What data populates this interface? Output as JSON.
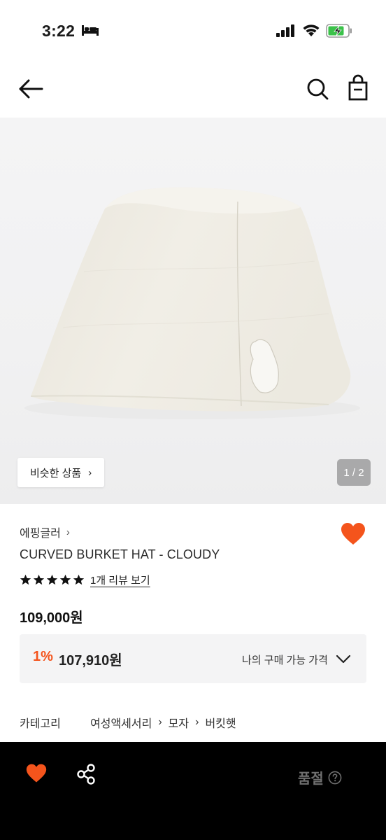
{
  "status_bar": {
    "time": "3:22"
  },
  "nav": {
    "back_icon": "arrow-left-icon",
    "search_icon": "search-icon",
    "bag_icon": "shopping-bag-icon"
  },
  "gallery": {
    "similar_label": "비슷한 상품",
    "counter": "1 / 2"
  },
  "product": {
    "brand": "에핑글러",
    "name": "CURVED BURKET HAT - CLOUDY",
    "rating_stars": 5,
    "review_link": "1개 리뷰 보기",
    "price": "109,000원",
    "liked": true
  },
  "buy_price": {
    "discount_rate": "1%",
    "price": "107,910원",
    "label": "나의 구매 가능 가격"
  },
  "category": {
    "label": "카테고리",
    "path": [
      "여성액세서리",
      "모자",
      "버킷햇"
    ]
  },
  "bottom_bar": {
    "status_label": "품절"
  },
  "colors": {
    "accent": "#f4541c",
    "bottom_bar_bg": "#000000",
    "soldout_text": "#6f6f6f"
  }
}
